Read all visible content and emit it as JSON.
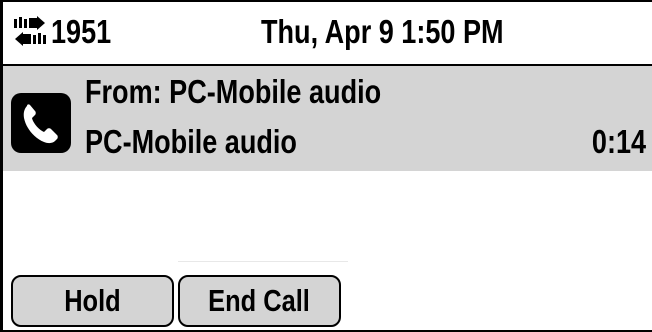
{
  "status_bar": {
    "line_icon": "line-transfer-icon",
    "extension": "1951",
    "datetime": "Thu, Apr 9 1:50 PM"
  },
  "call": {
    "icon": "handset-icon",
    "from_label": "From: PC-Mobile audio",
    "caller_name": "PC-Mobile audio",
    "duration": "0:14"
  },
  "softkeys": [
    {
      "label": "Hold"
    },
    {
      "label": "End Call"
    }
  ],
  "colors": {
    "panel_bg": "#d4d4d4",
    "text": "#000000",
    "background": "#ffffff"
  }
}
